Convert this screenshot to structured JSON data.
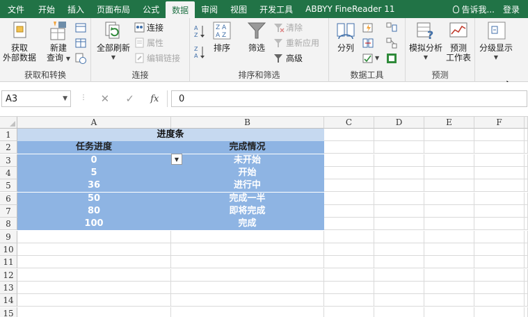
{
  "tabs": [
    {
      "label": "文件",
      "active": false
    },
    {
      "label": "开始",
      "active": false
    },
    {
      "label": "插入",
      "active": false
    },
    {
      "label": "页面布局",
      "active": false
    },
    {
      "label": "公式",
      "active": false
    },
    {
      "label": "数据",
      "active": true
    },
    {
      "label": "审阅",
      "active": false
    },
    {
      "label": "视图",
      "active": false
    },
    {
      "label": "开发工具",
      "active": false
    },
    {
      "label": "ABBYY FineReader 11",
      "active": false
    }
  ],
  "tell_me": "告诉我...",
  "login": "登录",
  "ribbon": {
    "get_external_line1": "获取",
    "get_external_line2": "外部数据",
    "new_query_line1": "新建",
    "new_query_line2": "查询",
    "group_get_transform": "获取和转换",
    "refresh_all": "全部刷新",
    "connections": "连接",
    "properties": "属性",
    "edit_links": "编辑链接",
    "group_connections": "连接",
    "sort": "排序",
    "filter": "筛选",
    "clear": "清除",
    "reapply": "重新应用",
    "advanced": "高级",
    "group_sort_filter": "排序和筛选",
    "text_to_columns": "分列",
    "group_data_tools": "数据工具",
    "what_if_line1": "模拟分析",
    "forecast_line1": "预测",
    "forecast_line2": "工作表",
    "group_forecast": "预测",
    "outline": "分级显示"
  },
  "formula_bar": {
    "name_box": "A3",
    "value": "0"
  },
  "columns": [
    "A",
    "B",
    "C",
    "D",
    "E",
    "F"
  ],
  "rows": [
    "1",
    "2",
    "3",
    "4",
    "5",
    "6",
    "7",
    "8",
    "9",
    "10",
    "11",
    "12",
    "13",
    "14",
    "15"
  ],
  "table": {
    "title": "进度条",
    "header_a": "任务进度",
    "header_b": "完成情况",
    "data": [
      {
        "a": "0",
        "b": "未开始"
      },
      {
        "a": "5",
        "b": "开始"
      },
      {
        "a": "36",
        "b": "进行中"
      },
      {
        "a": "50",
        "b": "完成一半"
      },
      {
        "a": "80",
        "b": "即将完成"
      },
      {
        "a": "100",
        "b": "完成"
      }
    ]
  },
  "colors": {
    "ribbon_green": "#217346",
    "table_blue": "#8eb4e3",
    "title_blue": "#c6d9f0"
  }
}
